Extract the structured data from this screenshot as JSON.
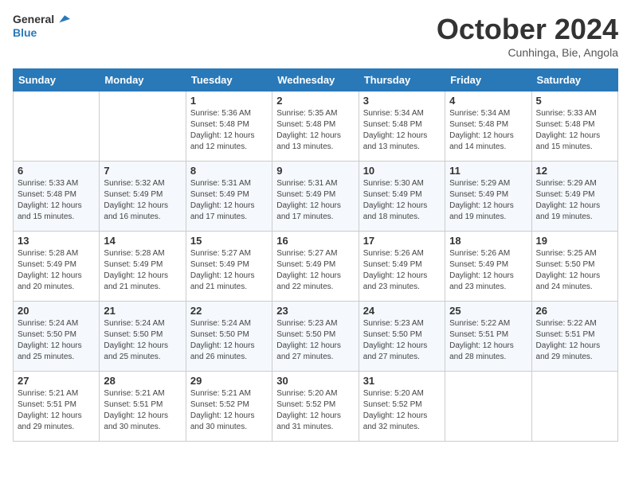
{
  "header": {
    "logo_line1": "General",
    "logo_line2": "Blue",
    "month": "October 2024",
    "location": "Cunhinga, Bie, Angola"
  },
  "weekdays": [
    "Sunday",
    "Monday",
    "Tuesday",
    "Wednesday",
    "Thursday",
    "Friday",
    "Saturday"
  ],
  "weeks": [
    [
      {
        "day": "",
        "info": ""
      },
      {
        "day": "",
        "info": ""
      },
      {
        "day": "1",
        "info": "Sunrise: 5:36 AM\nSunset: 5:48 PM\nDaylight: 12 hours and 12 minutes."
      },
      {
        "day": "2",
        "info": "Sunrise: 5:35 AM\nSunset: 5:48 PM\nDaylight: 12 hours and 13 minutes."
      },
      {
        "day": "3",
        "info": "Sunrise: 5:34 AM\nSunset: 5:48 PM\nDaylight: 12 hours and 13 minutes."
      },
      {
        "day": "4",
        "info": "Sunrise: 5:34 AM\nSunset: 5:48 PM\nDaylight: 12 hours and 14 minutes."
      },
      {
        "day": "5",
        "info": "Sunrise: 5:33 AM\nSunset: 5:48 PM\nDaylight: 12 hours and 15 minutes."
      }
    ],
    [
      {
        "day": "6",
        "info": "Sunrise: 5:33 AM\nSunset: 5:48 PM\nDaylight: 12 hours and 15 minutes."
      },
      {
        "day": "7",
        "info": "Sunrise: 5:32 AM\nSunset: 5:49 PM\nDaylight: 12 hours and 16 minutes."
      },
      {
        "day": "8",
        "info": "Sunrise: 5:31 AM\nSunset: 5:49 PM\nDaylight: 12 hours and 17 minutes."
      },
      {
        "day": "9",
        "info": "Sunrise: 5:31 AM\nSunset: 5:49 PM\nDaylight: 12 hours and 17 minutes."
      },
      {
        "day": "10",
        "info": "Sunrise: 5:30 AM\nSunset: 5:49 PM\nDaylight: 12 hours and 18 minutes."
      },
      {
        "day": "11",
        "info": "Sunrise: 5:29 AM\nSunset: 5:49 PM\nDaylight: 12 hours and 19 minutes."
      },
      {
        "day": "12",
        "info": "Sunrise: 5:29 AM\nSunset: 5:49 PM\nDaylight: 12 hours and 19 minutes."
      }
    ],
    [
      {
        "day": "13",
        "info": "Sunrise: 5:28 AM\nSunset: 5:49 PM\nDaylight: 12 hours and 20 minutes."
      },
      {
        "day": "14",
        "info": "Sunrise: 5:28 AM\nSunset: 5:49 PM\nDaylight: 12 hours and 21 minutes."
      },
      {
        "day": "15",
        "info": "Sunrise: 5:27 AM\nSunset: 5:49 PM\nDaylight: 12 hours and 21 minutes."
      },
      {
        "day": "16",
        "info": "Sunrise: 5:27 AM\nSunset: 5:49 PM\nDaylight: 12 hours and 22 minutes."
      },
      {
        "day": "17",
        "info": "Sunrise: 5:26 AM\nSunset: 5:49 PM\nDaylight: 12 hours and 23 minutes."
      },
      {
        "day": "18",
        "info": "Sunrise: 5:26 AM\nSunset: 5:49 PM\nDaylight: 12 hours and 23 minutes."
      },
      {
        "day": "19",
        "info": "Sunrise: 5:25 AM\nSunset: 5:50 PM\nDaylight: 12 hours and 24 minutes."
      }
    ],
    [
      {
        "day": "20",
        "info": "Sunrise: 5:24 AM\nSunset: 5:50 PM\nDaylight: 12 hours and 25 minutes."
      },
      {
        "day": "21",
        "info": "Sunrise: 5:24 AM\nSunset: 5:50 PM\nDaylight: 12 hours and 25 minutes."
      },
      {
        "day": "22",
        "info": "Sunrise: 5:24 AM\nSunset: 5:50 PM\nDaylight: 12 hours and 26 minutes."
      },
      {
        "day": "23",
        "info": "Sunrise: 5:23 AM\nSunset: 5:50 PM\nDaylight: 12 hours and 27 minutes."
      },
      {
        "day": "24",
        "info": "Sunrise: 5:23 AM\nSunset: 5:50 PM\nDaylight: 12 hours and 27 minutes."
      },
      {
        "day": "25",
        "info": "Sunrise: 5:22 AM\nSunset: 5:51 PM\nDaylight: 12 hours and 28 minutes."
      },
      {
        "day": "26",
        "info": "Sunrise: 5:22 AM\nSunset: 5:51 PM\nDaylight: 12 hours and 29 minutes."
      }
    ],
    [
      {
        "day": "27",
        "info": "Sunrise: 5:21 AM\nSunset: 5:51 PM\nDaylight: 12 hours and 29 minutes."
      },
      {
        "day": "28",
        "info": "Sunrise: 5:21 AM\nSunset: 5:51 PM\nDaylight: 12 hours and 30 minutes."
      },
      {
        "day": "29",
        "info": "Sunrise: 5:21 AM\nSunset: 5:52 PM\nDaylight: 12 hours and 30 minutes."
      },
      {
        "day": "30",
        "info": "Sunrise: 5:20 AM\nSunset: 5:52 PM\nDaylight: 12 hours and 31 minutes."
      },
      {
        "day": "31",
        "info": "Sunrise: 5:20 AM\nSunset: 5:52 PM\nDaylight: 12 hours and 32 minutes."
      },
      {
        "day": "",
        "info": ""
      },
      {
        "day": "",
        "info": ""
      }
    ]
  ]
}
